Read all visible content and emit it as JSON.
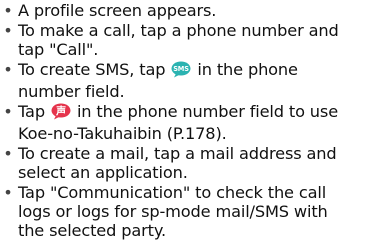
{
  "bullet_char": "•",
  "items": [
    {
      "lines": [
        "A profile screen appears."
      ]
    },
    {
      "lines": [
        "To make a call, tap a phone number and",
        "tap \"Call\"."
      ]
    },
    {
      "pre": "To create SMS, tap",
      "icon": "sms-icon",
      "icon_text": "SMS",
      "post": "in the phone",
      "line2": "number field."
    },
    {
      "pre": "Tap",
      "icon": "voice-icon",
      "icon_text": "声",
      "post": "in the phone number field to use",
      "line2": "Koe-no-Takuhaibin (P.178)."
    },
    {
      "lines": [
        "To create a mail, tap a mail address and",
        "select an application."
      ]
    },
    {
      "lines": [
        "Tap \"Communication\" to check the call",
        "logs or logs for sp-mode mail/SMS with",
        "the selected party."
      ]
    }
  ],
  "colors": {
    "text": "#111111",
    "sms_icon_bg": "#2bb3b1",
    "voice_icon_bg": "#e5344c"
  }
}
